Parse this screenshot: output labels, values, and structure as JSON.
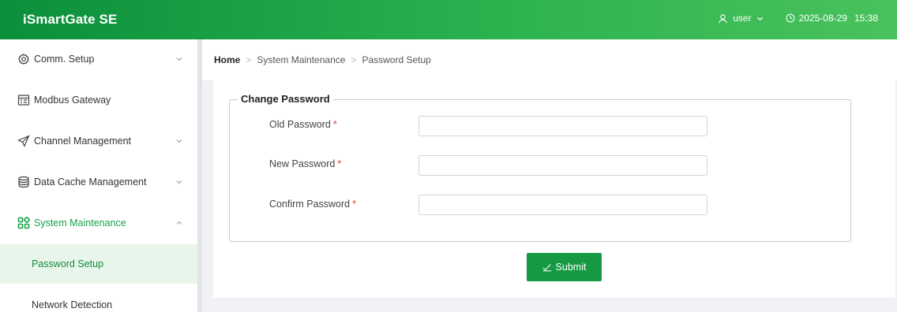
{
  "header": {
    "app_title": "iSmartGate SE",
    "user_label": "user",
    "date": "2025-08-29",
    "time": "15:38"
  },
  "sidebar": {
    "items": [
      {
        "label": "Comm. Setup",
        "icon": "gear-icon",
        "expandable": true
      },
      {
        "label": "Modbus Gateway",
        "icon": "gateway-icon",
        "expandable": false
      },
      {
        "label": "Channel Management",
        "icon": "send-icon",
        "expandable": true
      },
      {
        "label": "Data Cache Management",
        "icon": "database-icon",
        "expandable": true
      },
      {
        "label": "System Maintenance",
        "icon": "apps-icon",
        "expandable": true,
        "expanded": true
      }
    ],
    "subitems": [
      {
        "label": "Password Setup",
        "selected": true
      },
      {
        "label": "Network Detection",
        "selected": false
      }
    ]
  },
  "breadcrumb": {
    "home": "Home",
    "level1": "System Maintenance",
    "level2": "Password Setup"
  },
  "form": {
    "legend": "Change Password",
    "required_mark": "*",
    "fields": [
      {
        "label": "Old Password",
        "value": "",
        "placeholder": ""
      },
      {
        "label": "New Password",
        "value": "",
        "placeholder": ""
      },
      {
        "label": "Confirm Password",
        "value": "",
        "placeholder": ""
      }
    ],
    "submit_label": "Submit"
  },
  "colors": {
    "brand_green": "#159a43",
    "active_text": "#16a34a",
    "required": "#e53935"
  }
}
